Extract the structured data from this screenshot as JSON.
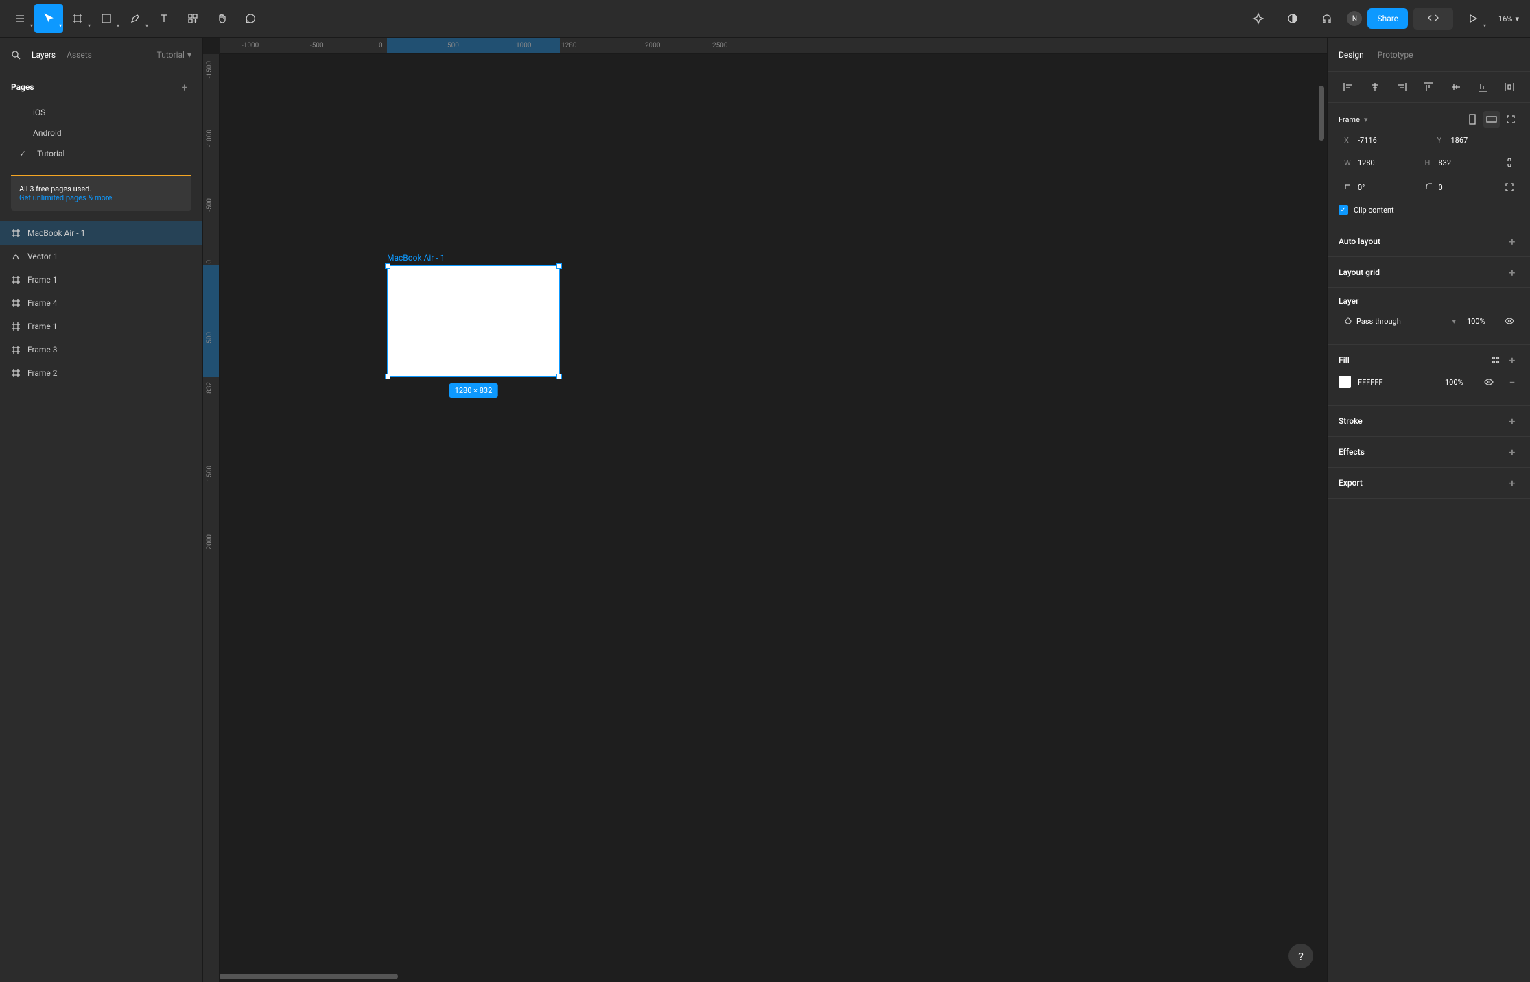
{
  "toolbar": {
    "zoom": "16%",
    "share_label": "Share",
    "avatar_initial": "N"
  },
  "left": {
    "tabs": {
      "layers": "Layers",
      "assets": "Assets"
    },
    "project_name": "Tutorial",
    "pages_header": "Pages",
    "pages": [
      {
        "name": "iOS"
      },
      {
        "name": "Android"
      },
      {
        "name": "Tutorial",
        "active": true
      }
    ],
    "upsell": {
      "line1": "All 3 free pages used.",
      "link": "Get unlimited pages & more"
    },
    "layers": [
      {
        "name": "MacBook Air - 1",
        "type": "frame",
        "selected": true
      },
      {
        "name": "Vector 1",
        "type": "vector"
      },
      {
        "name": "Frame 1",
        "type": "frame"
      },
      {
        "name": "Frame 4",
        "type": "frame"
      },
      {
        "name": "Frame 1",
        "type": "frame"
      },
      {
        "name": "Frame 3",
        "type": "frame"
      },
      {
        "name": "Frame 2",
        "type": "frame"
      }
    ]
  },
  "canvas": {
    "ruler_h": [
      "-1000",
      "-500",
      "0",
      "500",
      "1000",
      "1280",
      "2000",
      "2500"
    ],
    "ruler_v": [
      "-1500",
      "-1000",
      "-500",
      "0",
      "500",
      "832",
      "1500",
      "2000"
    ],
    "frame_label": "MacBook Air - 1",
    "dims_badge": "1280 × 832"
  },
  "right": {
    "tabs": {
      "design": "Design",
      "prototype": "Prototype"
    },
    "frame_label": "Frame",
    "position": {
      "x": "-7116",
      "y": "1867"
    },
    "size": {
      "w": "1280",
      "h": "832"
    },
    "rotation": "0°",
    "corner_radius": "0",
    "clip_content_label": "Clip content",
    "clip_content_checked": true,
    "auto_layout": "Auto layout",
    "layout_grid": "Layout grid",
    "layer_label": "Layer",
    "blend_mode": "Pass through",
    "layer_opacity": "100%",
    "fill_label": "Fill",
    "fill_color": "FFFFFF",
    "fill_opacity": "100%",
    "stroke_label": "Stroke",
    "effects_label": "Effects",
    "export_label": "Export"
  }
}
